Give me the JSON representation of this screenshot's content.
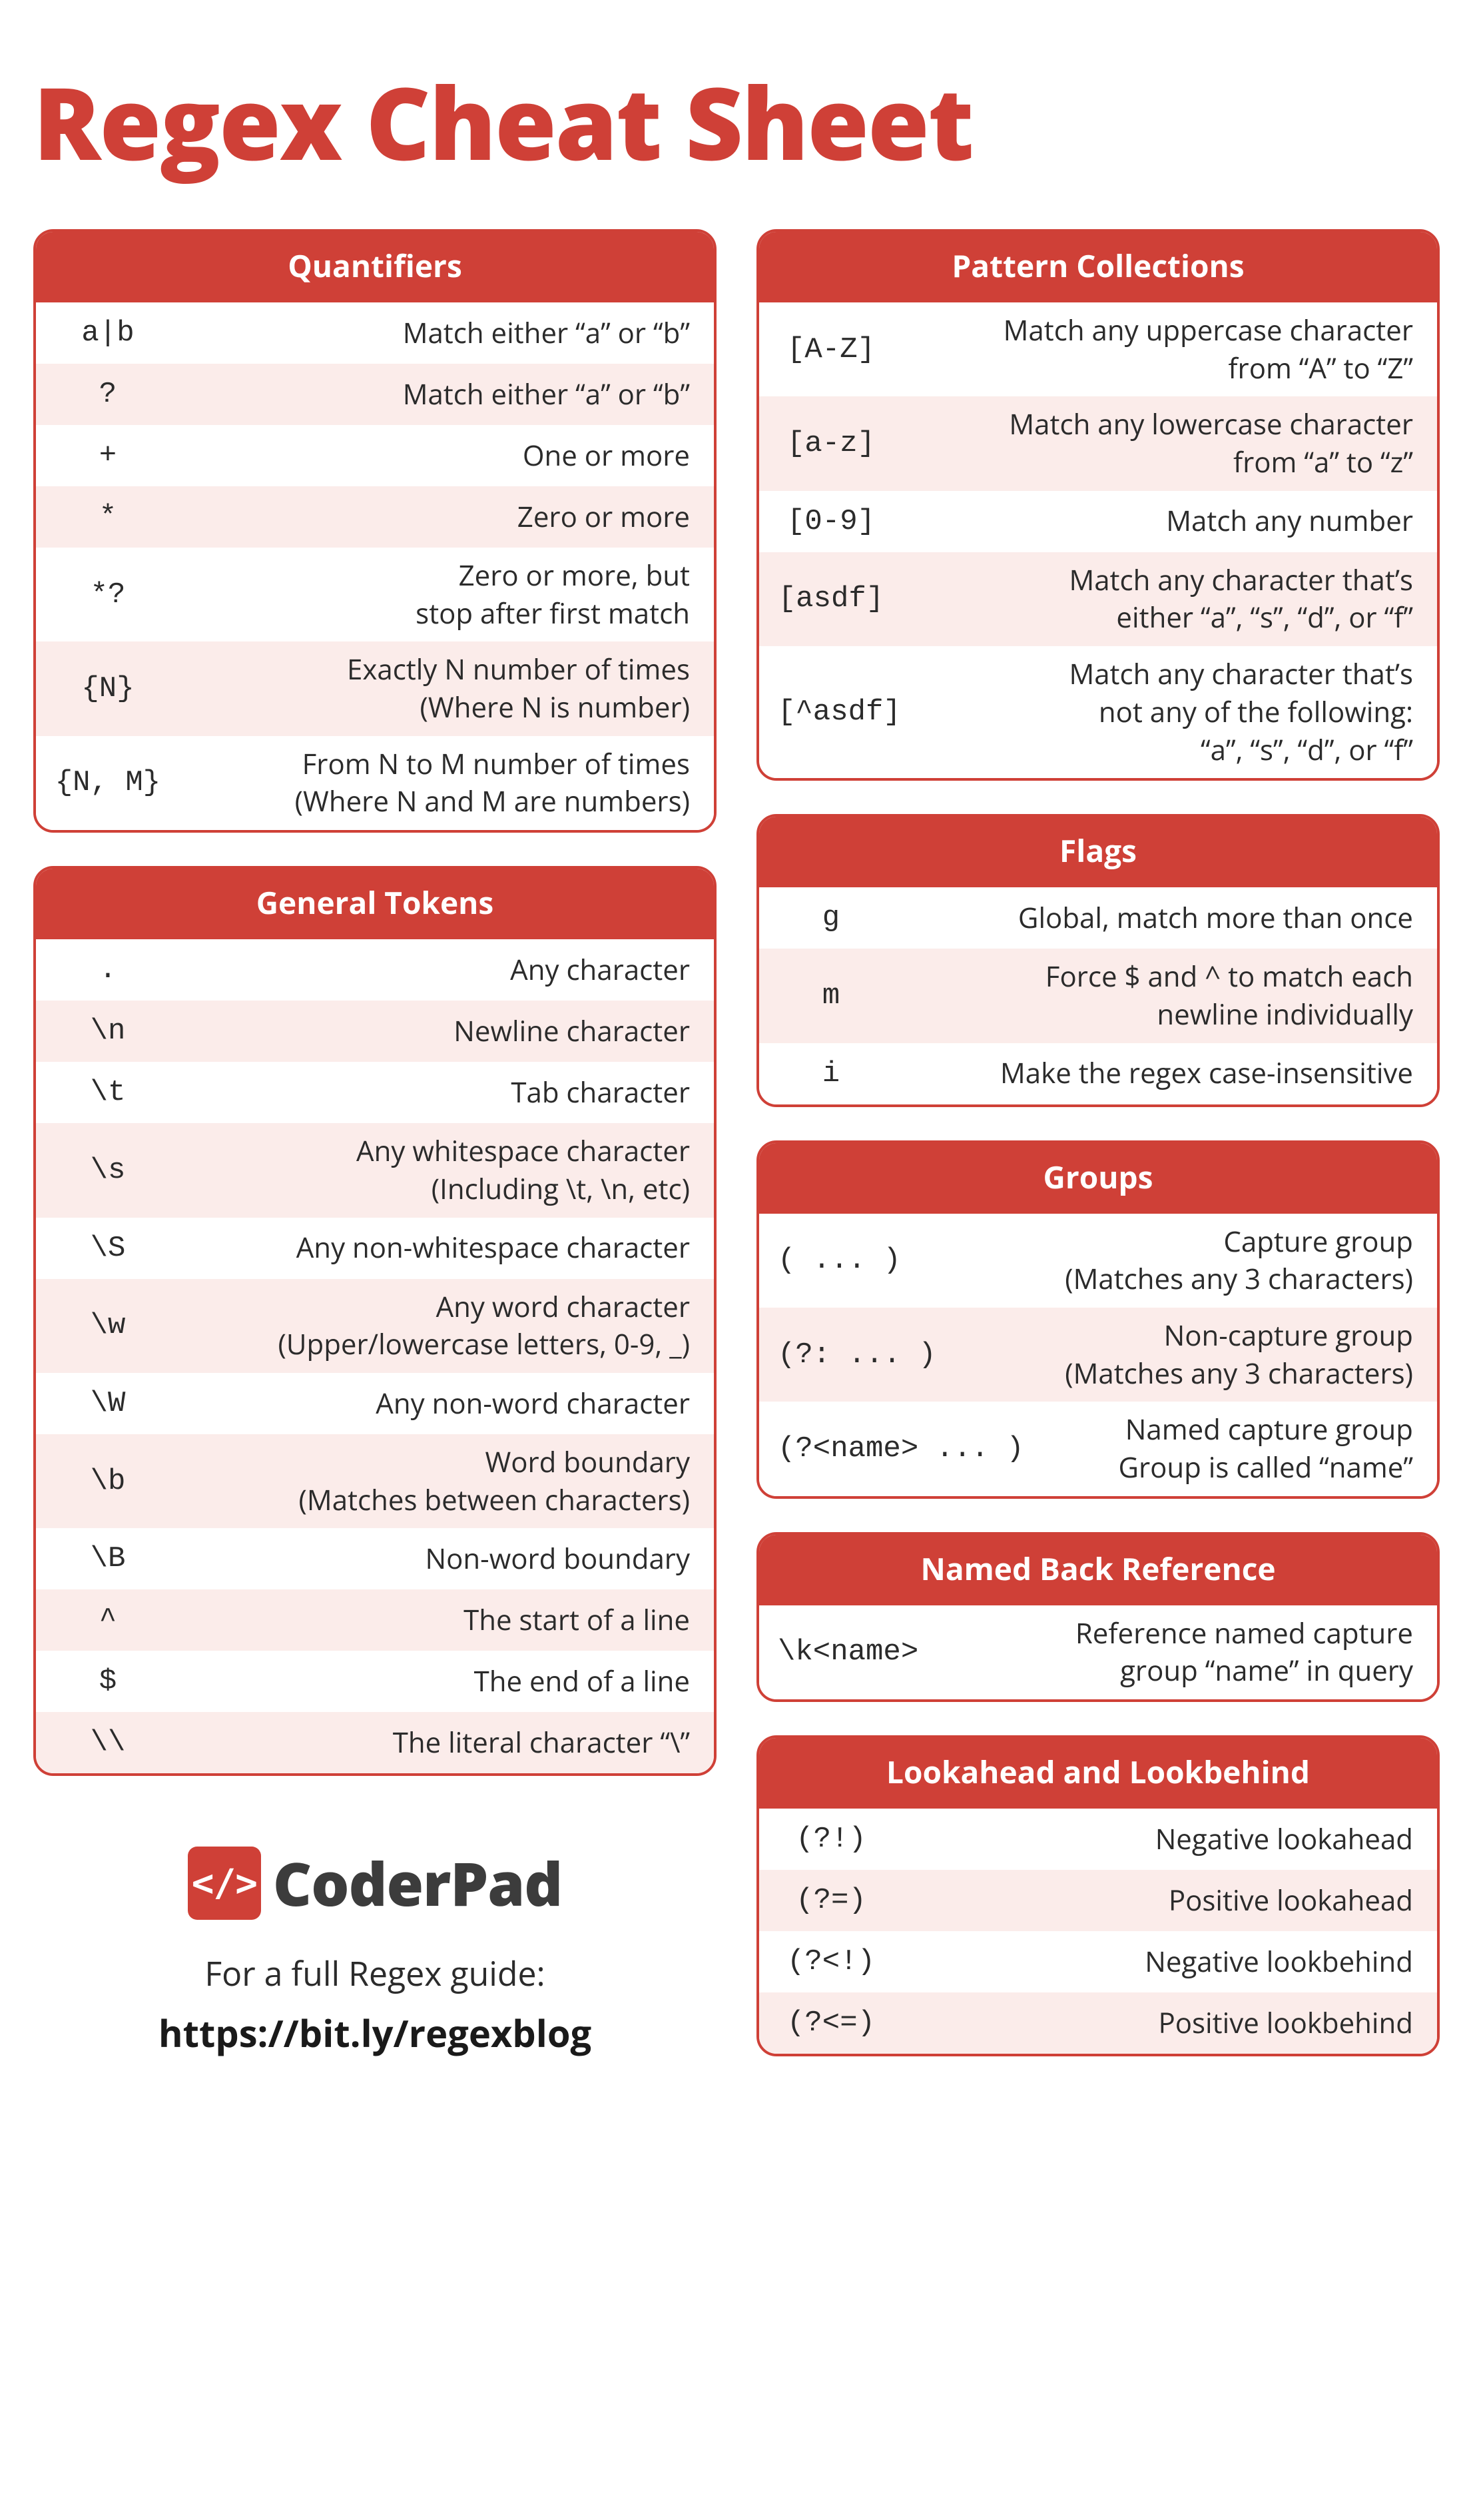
{
  "title": "Regex Cheat Sheet",
  "left_cards": [
    {
      "title": "Quantifiers",
      "rows": [
        {
          "code": "a|b",
          "desc": "Match either “a” or “b”"
        },
        {
          "code": "?",
          "desc": "Match either “a” or “b”"
        },
        {
          "code": "+",
          "desc": "One or more"
        },
        {
          "code": "*",
          "desc": "Zero or more"
        },
        {
          "code": "*?",
          "desc": "Zero or more, but\nstop after first match"
        },
        {
          "code": "{N}",
          "desc": "Exactly N number of times\n(Where N is number)"
        },
        {
          "code": "{N, M}",
          "desc": "From N to M number of times\n(Where N and M are numbers)"
        }
      ]
    },
    {
      "title": "General Tokens",
      "rows": [
        {
          "code": ".",
          "desc": "Any character"
        },
        {
          "code": "\\n",
          "desc": "Newline character"
        },
        {
          "code": "\\t",
          "desc": "Tab character"
        },
        {
          "code": "\\s",
          "desc": "Any whitespace character\n(Including \\t, \\n, etc)"
        },
        {
          "code": "\\S",
          "desc": "Any non-whitespace character"
        },
        {
          "code": "\\w",
          "desc": "Any word character\n(Upper/lowercase letters, 0-9, _)"
        },
        {
          "code": "\\W",
          "desc": "Any non-word character"
        },
        {
          "code": "\\b",
          "desc": "Word boundary\n(Matches between characters)"
        },
        {
          "code": "\\B",
          "desc": "Non-word boundary"
        },
        {
          "code": "^",
          "desc": "The start of a line"
        },
        {
          "code": "$",
          "desc": "The end of a line"
        },
        {
          "code": "\\\\",
          "desc": "The literal character “\\”"
        }
      ]
    }
  ],
  "right_cards": [
    {
      "title": "Pattern Collections",
      "rows": [
        {
          "code": "[A-Z]",
          "desc": "Match any uppercase character\nfrom “A” to “Z”"
        },
        {
          "code": "[a-z]",
          "desc": "Match any lowercase character\nfrom “a” to “z”"
        },
        {
          "code": "[0-9]",
          "desc": "Match any number"
        },
        {
          "code": "[asdf]",
          "desc": "Match any character that’s\neither “a”, “s”, “d”, or “f”"
        },
        {
          "code": "[^asdf]",
          "desc": "Match any character that’s\nnot any of the following:\n“a”, “s”, “d”, or “f”"
        }
      ]
    },
    {
      "title": "Flags",
      "rows": [
        {
          "code": "g",
          "desc": "Global, match more than once"
        },
        {
          "code": "m",
          "desc": "Force $ and ^ to match each\nnewline individually"
        },
        {
          "code": "i",
          "desc": "Make the regex case-insensitive"
        }
      ]
    },
    {
      "title": "Groups",
      "rows": [
        {
          "code": "( ... )",
          "desc": "Capture group\n(Matches any 3 characters)"
        },
        {
          "code": "(?: ... )",
          "desc": "Non-capture group\n(Matches any 3 characters)"
        },
        {
          "code": "(?<name> ... )",
          "desc": "Named capture group\nGroup is called “name”"
        }
      ]
    },
    {
      "title": "Named Back Reference",
      "rows": [
        {
          "code": "\\k<name>",
          "desc": "Reference named capture\ngroup “name” in query"
        }
      ]
    },
    {
      "title": "Lookahead and Lookbehind",
      "rows": [
        {
          "code": "(?!)",
          "desc": "Negative lookahead"
        },
        {
          "code": "(?=)",
          "desc": "Positive lookahead"
        },
        {
          "code": "(?<!)",
          "desc": "Negative lookbehind"
        },
        {
          "code": "(?<=)",
          "desc": "Positive lookbehind"
        }
      ]
    }
  ],
  "footer": {
    "brand": "CoderPad",
    "guide_text": "For a full Regex guide:",
    "guide_link": "https://bit.ly/regexblog"
  }
}
